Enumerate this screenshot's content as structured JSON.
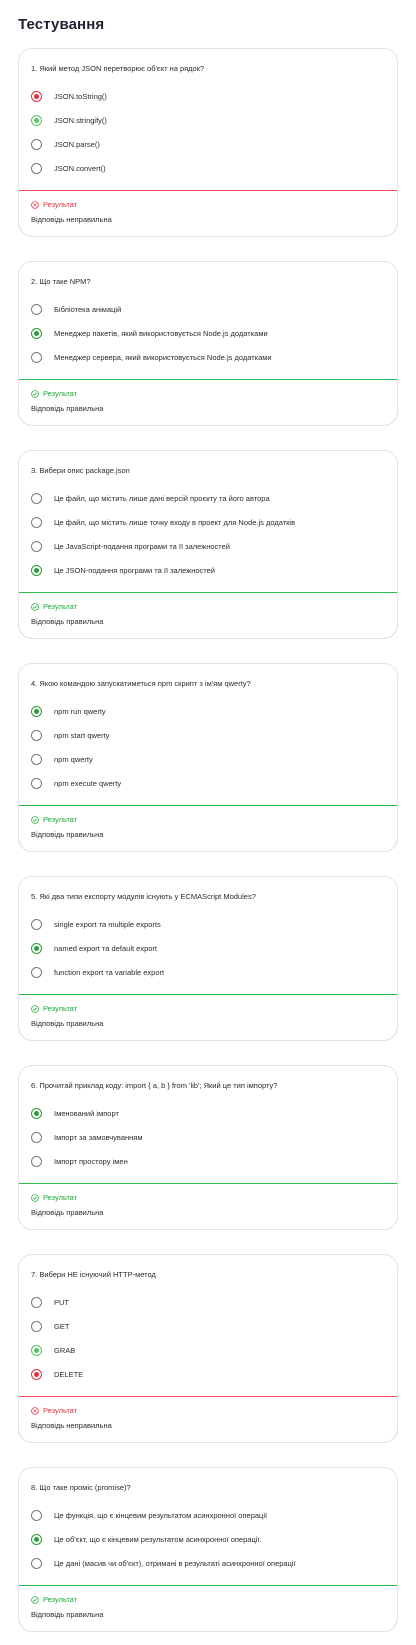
{
  "title": "Тестування",
  "questions": [
    {
      "text": "1. Який метод JSON перетворює об'єкт на рядок?",
      "options": [
        {
          "label": "JSON.toString()",
          "state": "wrong"
        },
        {
          "label": "JSON.stringify()",
          "state": "correct-hint"
        },
        {
          "label": "JSON.parse()",
          "state": "none"
        },
        {
          "label": "JSON.convert()",
          "state": "none"
        }
      ],
      "result": {
        "status": "bad",
        "title": "Результат",
        "message": "Відповідь неправильна"
      }
    },
    {
      "text": "2. Що таке NPM?",
      "options": [
        {
          "label": "Бібліотека анімацій",
          "state": "none"
        },
        {
          "label": "Менеджер пакетів, який використовується Node.js додатками",
          "state": "correct"
        },
        {
          "label": "Менеджер сервера, який використовується Node.js додатками",
          "state": "none"
        }
      ],
      "result": {
        "status": "ok",
        "title": "Результат",
        "message": "Відповідь правильна"
      }
    },
    {
      "text": "3. Вибери опис package.json",
      "options": [
        {
          "label": "Це файл, що містить лише дані версій проєкту та його автора",
          "state": "none"
        },
        {
          "label": "Це файл, що містить лише точку входу в проект для Node.js додатків",
          "state": "none"
        },
        {
          "label": "Це JavaScript-подання програми та її залежностей",
          "state": "none"
        },
        {
          "label": "Це JSON-подання програми та її залежностей",
          "state": "correct"
        }
      ],
      "result": {
        "status": "ok",
        "title": "Результат",
        "message": "Відповідь правильна"
      }
    },
    {
      "text": "4. Якою командою запускатиметься npm скрипт з ім'ям qwerty?",
      "options": [
        {
          "label": "npm run qwerty",
          "state": "correct"
        },
        {
          "label": "npm start qwerty",
          "state": "none"
        },
        {
          "label": "npm qwerty",
          "state": "none"
        },
        {
          "label": "npm execute qwerty",
          "state": "none"
        }
      ],
      "result": {
        "status": "ok",
        "title": "Результат",
        "message": "Відповідь правильна"
      }
    },
    {
      "text": "5. Які два типи експорту модулів існують у ECMAScript Modules?",
      "options": [
        {
          "label": "single export та multiple exports",
          "state": "none"
        },
        {
          "label": "named export та default export",
          "state": "correct"
        },
        {
          "label": "function export та variable export",
          "state": "none"
        }
      ],
      "result": {
        "status": "ok",
        "title": "Результат",
        "message": "Відповідь правильна"
      }
    },
    {
      "text": "6. Прочитай приклад коду: import { a, b } from 'lib'; Який це тип імпорту?",
      "options": [
        {
          "label": "Іменований імпорт",
          "state": "correct"
        },
        {
          "label": "Імпорт за замовчуванням",
          "state": "none"
        },
        {
          "label": "Імпорт простору імен",
          "state": "none"
        }
      ],
      "result": {
        "status": "ok",
        "title": "Результат",
        "message": "Відповідь правильна"
      }
    },
    {
      "text": "7. Вибери НЕ існуючий HTTP-метод",
      "options": [
        {
          "label": "PUT",
          "state": "none"
        },
        {
          "label": "GET",
          "state": "none"
        },
        {
          "label": "GRAB",
          "state": "correct-hint"
        },
        {
          "label": "DELETE",
          "state": "wrong"
        }
      ],
      "result": {
        "status": "bad",
        "title": "Результат",
        "message": "Відповідь неправильна"
      }
    },
    {
      "text": "8. Що таке проміс (promise)?",
      "options": [
        {
          "label": "Це функція, що є кінцевим результатом асинхронної операції",
          "state": "none"
        },
        {
          "label": "Це об'єкт, що є кінцевим результатом асинхронної операції.",
          "state": "correct"
        },
        {
          "label": "Це дані (масив чи об'єкт), отримані в результаті асинхронної операції",
          "state": "none"
        }
      ],
      "result": {
        "status": "ok",
        "title": "Результат",
        "message": "Відповідь правильна"
      }
    }
  ],
  "colors": {
    "correct": "#2e9d3a",
    "correct_hint": "#55c866",
    "wrong": "#e0323f",
    "ok_border": "#2cbf4c",
    "bad_border": "#ef4a57"
  },
  "icons": {
    "ok": "check-circle-icon",
    "bad": "x-circle-icon"
  }
}
